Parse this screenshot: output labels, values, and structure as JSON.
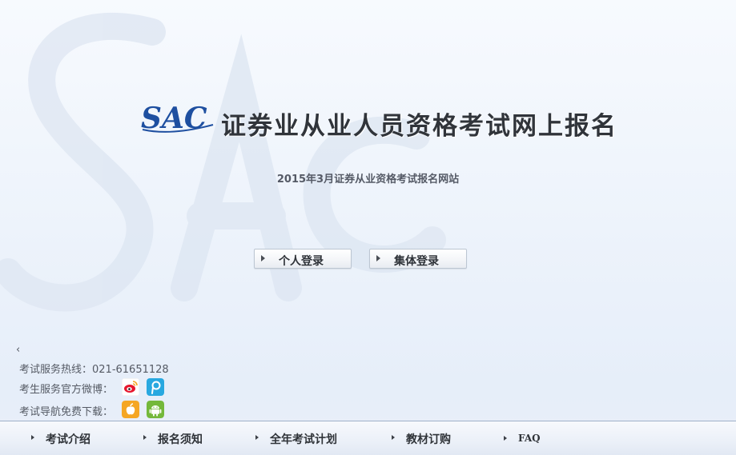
{
  "logo": {
    "text": "SAC"
  },
  "header": {
    "title": "证券业从业人员资格考试网上报名"
  },
  "subtitle": "2015年3月证券从业资格考试报名网站",
  "login": {
    "personal_label": "个人登录",
    "group_label": "集体登录"
  },
  "info": {
    "back_chevron": "‹",
    "hotline": "考试服务热线：021-61651128",
    "weibo_label": "考生服务官方微博：",
    "download_label": "考试导航免费下载："
  },
  "icons": {
    "weibo": "sina-weibo-icon",
    "tencent": "tencent-weibo-icon",
    "apple": "apple-icon",
    "android": "android-icon"
  },
  "colors": {
    "logo_blue": "#1e4fa0",
    "title_text": "#30343a",
    "weibo_red": "#e6162d",
    "tencent_blue": "#28a8e0",
    "apple_orange": "#f5a623",
    "android_green": "#74b83b"
  },
  "nav": {
    "items": [
      {
        "label": "考试介绍"
      },
      {
        "label": "报名须知"
      },
      {
        "label": "全年考试计划"
      },
      {
        "label": "教材订购"
      },
      {
        "label": "FAQ"
      }
    ]
  }
}
